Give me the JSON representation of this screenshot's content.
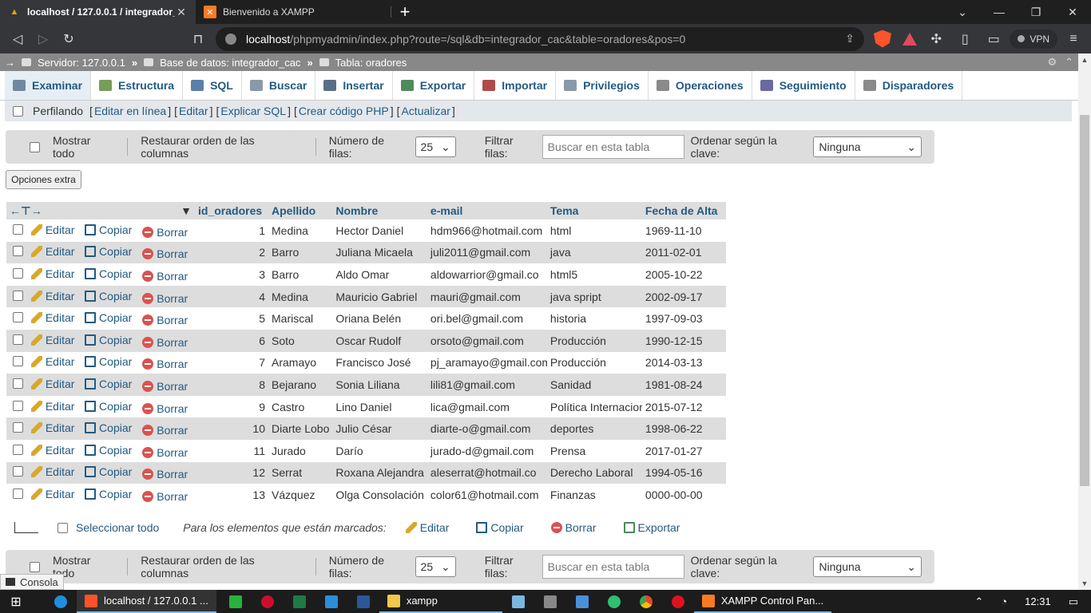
{
  "browser": {
    "tabs": [
      {
        "title": "localhost / 127.0.0.1 / integrador_",
        "active": true
      },
      {
        "title": "Bienvenido a XAMPP",
        "active": false
      }
    ],
    "url_host": "localhost",
    "url_path": "/phpmyadmin/index.php?route=/sql&db=integrador_cac&table=oradores&pos=0",
    "vpn_label": "VPN"
  },
  "breadcrumb": {
    "server": "Servidor: 127.0.0.1",
    "database": "Base de datos: integrador_cac",
    "table": "Tabla: oradores"
  },
  "tabs": [
    {
      "label": "Examinar",
      "icon": "browse-icon",
      "color": "#6f8aa0"
    },
    {
      "label": "Estructura",
      "icon": "structure-icon",
      "color": "#7a9c5a"
    },
    {
      "label": "SQL",
      "icon": "sql-icon",
      "color": "#5a7fa8"
    },
    {
      "label": "Buscar",
      "icon": "search-icon",
      "color": "#8899aa"
    },
    {
      "label": "Insertar",
      "icon": "insert-icon",
      "color": "#5a6e86"
    },
    {
      "label": "Exportar",
      "icon": "export-icon",
      "color": "#4f8a5a"
    },
    {
      "label": "Importar",
      "icon": "import-icon",
      "color": "#b04a4a"
    },
    {
      "label": "Privilegios",
      "icon": "privileges-icon",
      "color": "#8899aa"
    },
    {
      "label": "Operaciones",
      "icon": "operations-icon",
      "color": "#8a8a8a"
    },
    {
      "label": "Seguimiento",
      "icon": "tracking-icon",
      "color": "#6a6aa0"
    },
    {
      "label": "Disparadores",
      "icon": "triggers-icon",
      "color": "#8a8a8a"
    }
  ],
  "profiling": {
    "label": "Perfilando",
    "links": [
      "Editar en línea",
      "Editar",
      "Explicar SQL",
      "Crear código PHP",
      "Actualizar"
    ]
  },
  "navpanel": {
    "show_all": "Mostrar todo",
    "restore_order": "Restaurar orden de las columnas",
    "rows_label": "Número de filas:",
    "rows_value": "25",
    "filter_label": "Filtrar filas:",
    "filter_placeholder": "Buscar en esta tabla",
    "sort_label": "Ordenar según la clave:",
    "sort_value": "Ninguna"
  },
  "extra_options": "Opciones extra",
  "table": {
    "columns": [
      "id_oradores",
      "Apellido",
      "Nombre",
      "e-mail",
      "Tema",
      "Fecha de Alta"
    ],
    "actions": {
      "edit": "Editar",
      "copy": "Copiar",
      "delete": "Borrar"
    },
    "rows": [
      {
        "id": "1",
        "apellido": "Medina",
        "nombre": "Hector Daniel",
        "email": "hdm966@hotmail.com",
        "tema": "html",
        "fecha": "1969-11-10"
      },
      {
        "id": "2",
        "apellido": "Barro",
        "nombre": "Juliana Micaela",
        "email": "juli2011@gmail.com",
        "tema": "java",
        "fecha": "2011-02-01"
      },
      {
        "id": "3",
        "apellido": "Barro",
        "nombre": "Aldo Omar",
        "email": "aldowarrior@gmail.co",
        "tema": "html5",
        "fecha": "2005-10-22"
      },
      {
        "id": "4",
        "apellido": "Medina",
        "nombre": "Mauricio Gabriel",
        "email": "mauri@gmail.com",
        "tema": "java spript",
        "fecha": "2002-09-17"
      },
      {
        "id": "5",
        "apellido": "Mariscal",
        "nombre": "Oriana Belén",
        "email": "ori.bel@gmail.com",
        "tema": "historia",
        "fecha": "1997-09-03"
      },
      {
        "id": "6",
        "apellido": "Soto",
        "nombre": "Oscar Rudolf",
        "email": "orsoto@gmail.com",
        "tema": "Producción",
        "fecha": "1990-12-15"
      },
      {
        "id": "7",
        "apellido": "Aramayo",
        "nombre": "Francisco José",
        "email": "pj_aramayo@gmail.com",
        "tema": "Producción",
        "fecha": "2014-03-13"
      },
      {
        "id": "8",
        "apellido": "Bejarano",
        "nombre": "Sonia Liliana",
        "email": "lili81@gmail.com",
        "tema": "Sanidad",
        "fecha": "1981-08-24"
      },
      {
        "id": "9",
        "apellido": "Castro",
        "nombre": "Lino Daniel",
        "email": "lica@gmail.com",
        "tema": "Política Internacion",
        "fecha": "2015-07-12"
      },
      {
        "id": "10",
        "apellido": "Diarte Lobo",
        "nombre": "Julio César",
        "email": "diarte-o@gmail.com",
        "tema": "deportes",
        "fecha": "1998-06-22"
      },
      {
        "id": "11",
        "apellido": "Jurado",
        "nombre": "Darío",
        "email": "jurado-d@gmail.com",
        "tema": "Prensa",
        "fecha": "2017-01-27"
      },
      {
        "id": "12",
        "apellido": "Serrat",
        "nombre": "Roxana Alejandra",
        "email": "aleserrat@hotmail.co",
        "tema": "Derecho Laboral",
        "fecha": "1994-05-16"
      },
      {
        "id": "13",
        "apellido": "Vázquez",
        "nombre": "Olga Consolación",
        "email": "color61@hotmail.com",
        "tema": "Finanzas",
        "fecha": "0000-00-00"
      }
    ]
  },
  "bulk": {
    "select_all": "Seleccionar todo",
    "marked": "Para los elementos que están marcados:",
    "edit": "Editar",
    "copy": "Copiar",
    "delete": "Borrar",
    "export": "Exportar"
  },
  "console_label": "Consola",
  "taskbar": {
    "brave_app": "localhost / 127.0.0.1 ...",
    "folder_app": "xampp",
    "xampp_app": "XAMPP Control Pan...",
    "clock": "12:31"
  }
}
